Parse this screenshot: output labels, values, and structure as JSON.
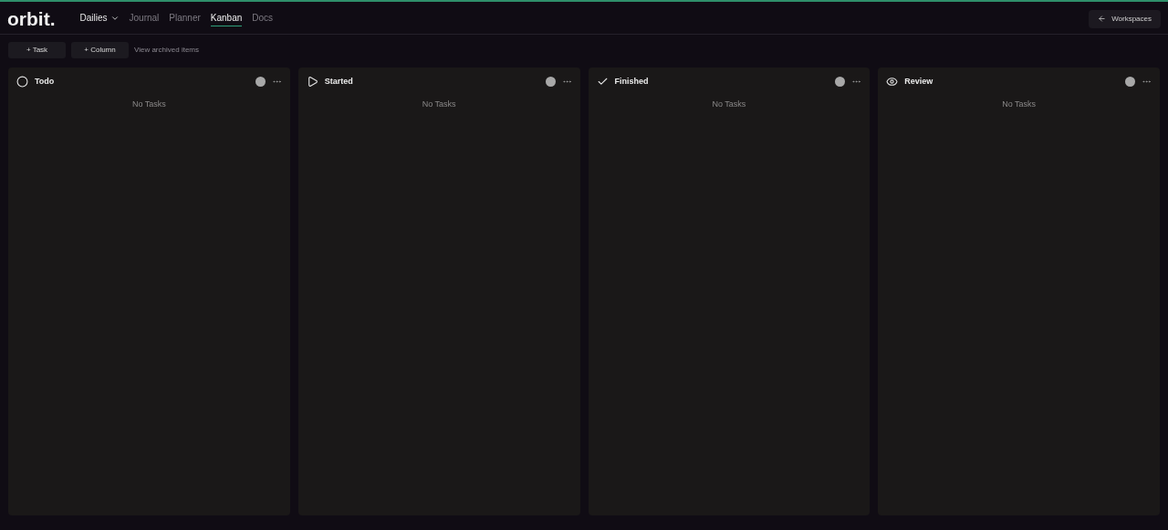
{
  "logo": "orbit.",
  "nav": [
    {
      "label": "Dailies",
      "kind": "dropdown",
      "selected": false
    },
    {
      "label": "Journal",
      "kind": "link",
      "selected": false
    },
    {
      "label": "Planner",
      "kind": "link",
      "selected": false
    },
    {
      "label": "Kanban",
      "kind": "link",
      "selected": true
    },
    {
      "label": "Docs",
      "kind": "link",
      "selected": false
    }
  ],
  "workspaces_button": "Workspaces",
  "toolbar": {
    "buttons": [
      "+ Task",
      "+ Column"
    ],
    "link": "View archived items"
  },
  "columns": [
    {
      "title": "Todo",
      "kind": "circle",
      "empty_text": "No Tasks"
    },
    {
      "title": "Started",
      "kind": "play",
      "empty_text": "No Tasks"
    },
    {
      "title": "Finished",
      "kind": "check",
      "empty_text": "No Tasks"
    },
    {
      "title": "Review",
      "kind": "eye",
      "empty_text": "No Tasks"
    }
  ]
}
